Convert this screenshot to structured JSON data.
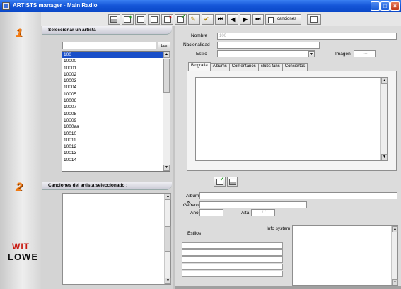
{
  "window": {
    "title": "ARTISTS manager   - Main Radio",
    "buttons": {
      "minimize": "_",
      "maximize": "□",
      "close": "×"
    }
  },
  "toolbar": {
    "nav_first": "⏮",
    "nav_prev": "◀",
    "nav_next": "▶",
    "nav_last": "⏭",
    "canciones_label": "canciones"
  },
  "side": {
    "section1_number": "1",
    "section2_number": "2",
    "logo_line1": "WIT",
    "logo_line2": "LOWE"
  },
  "artists_section": {
    "header": "Seleccionar un artista :",
    "search_button": "bus",
    "items": [
      "100",
      "10000",
      "10001",
      "10002",
      "10003",
      "10004",
      "10005",
      "10006",
      "10007",
      "10008",
      "10009",
      "1000aa",
      "10010",
      "10011",
      "10012",
      "10013",
      "10014"
    ],
    "selected_index": 0
  },
  "details": {
    "nombre_label": "Nombre",
    "nombre_value": "100",
    "nacionalidad_label": "Nacionalidad",
    "nacionalidad_value": "",
    "estilo_label": "Estilo",
    "estilo_value": "",
    "imagen_label": "Imagen",
    "imagen_value": "---"
  },
  "tabs": [
    "Biografia",
    "Albums",
    "Comentarios",
    "clubs fans",
    "Conciertos"
  ],
  "active_tab": "Biografia",
  "songs_section": {
    "header": "Canciones del artista  seleccionado :"
  },
  "album_info": {
    "album_label": "Album",
    "genero_label": "Género",
    "anio_label": "Año",
    "alta_label": "Alta",
    "alta_value": "  /  /",
    "estilos_label": "Estilos",
    "info_system_label": "Info system"
  }
}
